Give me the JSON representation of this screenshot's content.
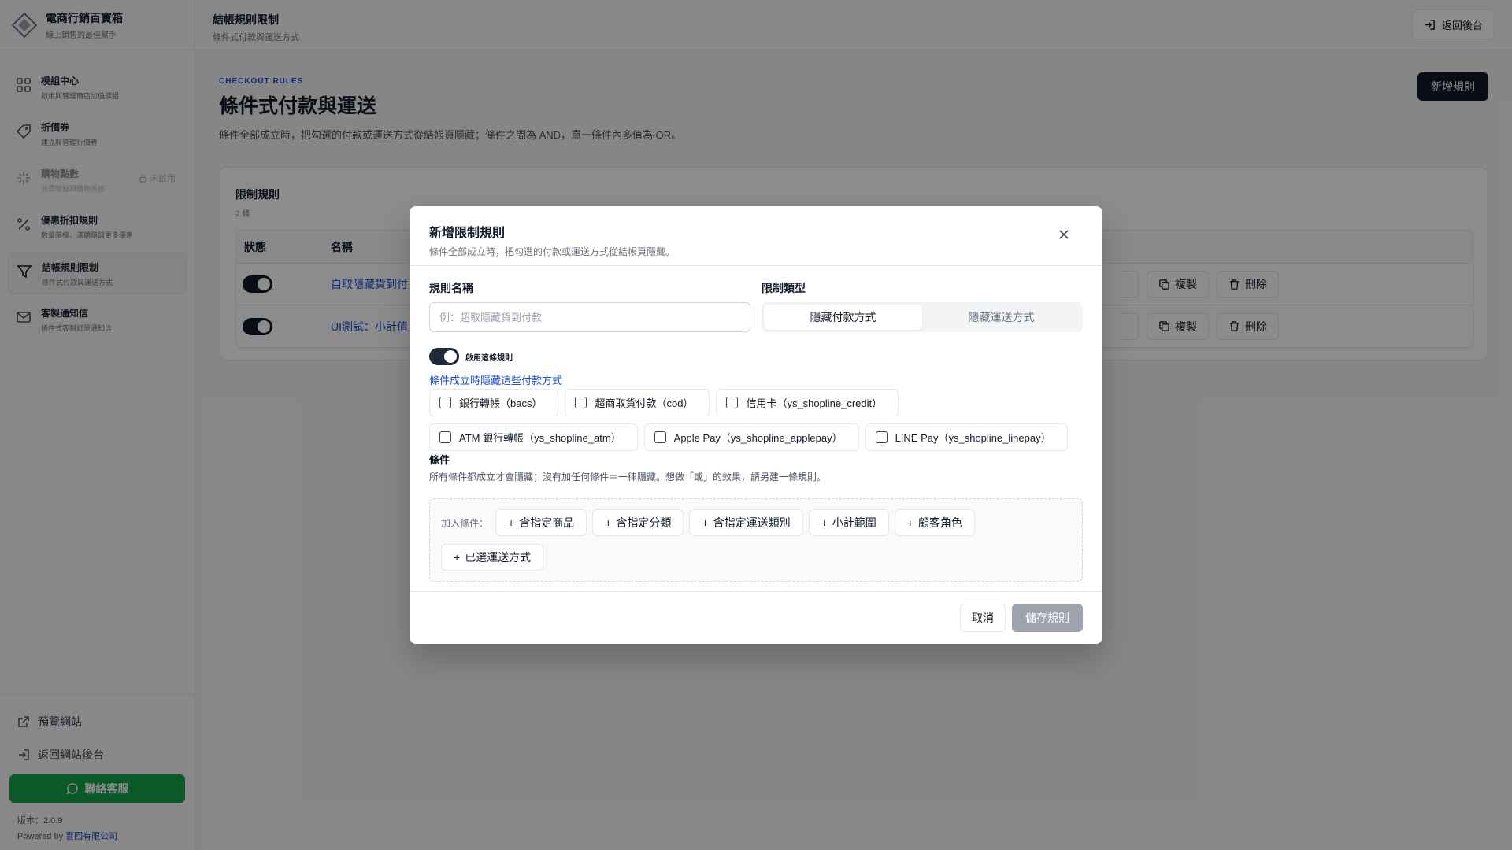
{
  "brand": {
    "title": "電商行銷百寶箱",
    "subtitle": "線上銷售的最佳幫手"
  },
  "sidebar": {
    "items": [
      {
        "title": "模組中心",
        "subtitle": "啟用與管理商店加值模組"
      },
      {
        "title": "折價券",
        "subtitle": "建立與管理折價券"
      },
      {
        "title": "購物點數",
        "subtitle": "消費贈點與購物折抵",
        "lock_label": "未啟用"
      },
      {
        "title": "優惠折扣規則",
        "subtitle": "數量階梯、滿額贈與更多優惠"
      },
      {
        "title": "結帳規則限制",
        "subtitle": "條件式付款與運送方式"
      },
      {
        "title": "客製通知信",
        "subtitle": "條件式客製訂單通知信"
      }
    ],
    "preview_label": "預覽網站",
    "back_site_label": "返回網站後台",
    "contact_label": "聯絡客服",
    "version": "版本：2.0.9",
    "powered_prefix": "Powered by",
    "powered_company": "喜回有限公司"
  },
  "topbar": {
    "title": "結帳規則限制",
    "subtitle": "條件式付款與運送方式",
    "back_label": "返回後台"
  },
  "main": {
    "eyebrow": "CHECKOUT RULES",
    "title": "條件式付款與運送",
    "description": "條件全部成立時，把勾選的付款或運送方式從結帳頁隱藏；條件之間為 AND，單一條件內多值為 OR。",
    "new_rule_label": "新增規則"
  },
  "rules_card": {
    "title": "限制規則",
    "count": "2 條",
    "columns": {
      "status": "狀態",
      "name": "名稱"
    },
    "rows": [
      {
        "name": "自取隱藏貨到付",
        "enabled": true
      },
      {
        "name": "UI測試：小計值",
        "enabled": true
      }
    ],
    "copy_label": "複製",
    "delete_label": "刪除"
  },
  "modal": {
    "title": "新增限制規則",
    "subtitle": "條件全部成立時，把勾選的付款或運送方式從結帳頁隱藏。",
    "name_label": "規則名稱",
    "name_placeholder": "例：超取隱藏貨到付款",
    "name_value": "",
    "type_label": "限制類型",
    "type_options": [
      "隱藏付款方式",
      "隱藏運送方式"
    ],
    "type_selected": "隱藏付款方式",
    "enable_label": "啟用這條規則",
    "enabled": true,
    "hide_label": "條件成立時隱藏這些付款方式",
    "payment_methods": [
      {
        "label": "銀行轉帳（bacs）",
        "checked": false
      },
      {
        "label": "超商取貨付款（cod）",
        "checked": false
      },
      {
        "label": "信用卡（ys_shopline_credit）",
        "checked": false
      },
      {
        "label": "ATM 銀行轉帳（ys_shopline_atm）",
        "checked": false
      },
      {
        "label": "Apple Pay（ys_shopline_applepay）",
        "checked": false
      },
      {
        "label": "LINE Pay（ys_shopline_linepay）",
        "checked": false
      }
    ],
    "conditions_label": "條件",
    "conditions_desc": "所有條件都成立才會隱藏；沒有加任何條件＝一律隱藏。想做「或」的效果，請另建一條規則。",
    "add_condition_label": "加入條件：",
    "condition_buttons": [
      "含指定商品",
      "含指定分類",
      "含指定運送類別",
      "小計範圍",
      "顧客角色",
      "已選運送方式"
    ],
    "cancel_label": "取消",
    "save_label": "儲存規則"
  },
  "colors": {
    "accent": "#1d4ed8",
    "dark": "#111827",
    "success": "#16a34a",
    "disabled": "#9ca3af"
  }
}
